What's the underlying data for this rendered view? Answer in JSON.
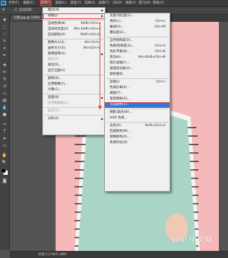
{
  "app": {
    "logo": "Ps"
  },
  "menubar": {
    "items": [
      {
        "label": "文件(F)",
        "active": false
      },
      {
        "label": "编辑(E)",
        "active": false
      },
      {
        "label": "图像(I)",
        "active": true
      },
      {
        "label": "图层(L)",
        "active": false
      },
      {
        "label": "类型(Y)",
        "active": false
      },
      {
        "label": "选择(S)",
        "active": false
      },
      {
        "label": "滤镜(T)",
        "active": false
      },
      {
        "label": "3D(D)",
        "active": false
      },
      {
        "label": "视图(V)",
        "active": false
      },
      {
        "label": "窗口(W)",
        "active": false
      },
      {
        "label": "帮助(H)",
        "active": false
      }
    ]
  },
  "options_bar": {
    "auto_select_label": "自动选择："
  },
  "document": {
    "tab_label": "人物.jpg @ 100%"
  },
  "status_bar": {
    "text": "文档:1.27M/5.28M"
  },
  "watermark": "php 中文网",
  "image_menu": {
    "items": [
      {
        "label": "模式(M)",
        "shortcut": "",
        "submenu": true
      },
      {
        "label": "调整(J)",
        "shortcut": "",
        "submenu": true,
        "highlight": true
      },
      {
        "sep": true
      },
      {
        "label": "自动色调(N)",
        "shortcut": "Shift+Ctrl+L"
      },
      {
        "label": "自动对比度(U)",
        "shortcut": "Alt+Shift+Ctrl+L"
      },
      {
        "label": "自动颜色(O)",
        "shortcut": "Shift+Ctrl+B"
      },
      {
        "sep": true
      },
      {
        "label": "图像大小(I)...",
        "shortcut": "Alt+Ctrl+I"
      },
      {
        "label": "画布大小(S)...",
        "shortcut": "Alt+Ctrl+C"
      },
      {
        "label": "图像旋转(G)",
        "shortcut": "",
        "submenu": true
      },
      {
        "label": "裁剪(P)",
        "shortcut": "",
        "disabled": true
      },
      {
        "label": "裁切(R)...",
        "shortcut": ""
      },
      {
        "label": "显示全部(V)",
        "shortcut": ""
      },
      {
        "sep": true
      },
      {
        "label": "复制(D)...",
        "shortcut": ""
      },
      {
        "label": "应用图像(Y)...",
        "shortcut": ""
      },
      {
        "label": "计算(C)...",
        "shortcut": ""
      },
      {
        "sep": true
      },
      {
        "label": "变量(B)",
        "shortcut": "",
        "submenu": true
      },
      {
        "label": "应用数据组(L)...",
        "shortcut": "",
        "disabled": true
      },
      {
        "sep": true
      },
      {
        "label": "陷印(T)...",
        "shortcut": "",
        "disabled": true
      },
      {
        "sep": true
      },
      {
        "label": "分析(A)",
        "shortcut": "",
        "submenu": true
      }
    ]
  },
  "adjust_menu": {
    "items": [
      {
        "label": "亮度/对比度(C)...",
        "shortcut": ""
      },
      {
        "label": "色阶(L)...",
        "shortcut": "Ctrl+L"
      },
      {
        "label": "曲线(U)...",
        "shortcut": "Ctrl+M"
      },
      {
        "label": "曝光度(E)...",
        "shortcut": ""
      },
      {
        "sep": true
      },
      {
        "label": "自然饱和度(V)...",
        "shortcut": ""
      },
      {
        "label": "色相/饱和度(H)...",
        "shortcut": "Ctrl+U"
      },
      {
        "label": "色彩平衡(B)...",
        "shortcut": "Ctrl+B"
      },
      {
        "label": "黑白(K)...",
        "shortcut": "Alt+Shift+Ctrl+B"
      },
      {
        "label": "照片滤镜(F)...",
        "shortcut": ""
      },
      {
        "label": "通道混合器(X)...",
        "shortcut": ""
      },
      {
        "label": "颜色查找...",
        "shortcut": ""
      },
      {
        "sep": true
      },
      {
        "label": "反相(I)",
        "shortcut": "Ctrl+I"
      },
      {
        "label": "色调分离(P)...",
        "shortcut": ""
      },
      {
        "label": "阈值(T)...",
        "shortcut": ""
      },
      {
        "label": "渐变映射(G)...",
        "shortcut": ""
      },
      {
        "label": "可选颜色(S)...",
        "shortcut": "",
        "highlight": true
      },
      {
        "sep": true
      },
      {
        "label": "阴影/高光(W)...",
        "shortcut": ""
      },
      {
        "label": "HDR 色调...",
        "shortcut": ""
      },
      {
        "sep": true
      },
      {
        "label": "去色(D)",
        "shortcut": "Shift+Ctrl+U"
      },
      {
        "label": "匹配颜色(M)...",
        "shortcut": ""
      },
      {
        "label": "替换颜色(R)...",
        "shortcut": ""
      },
      {
        "label": "色调均化(Q)",
        "shortcut": ""
      }
    ]
  },
  "colors": {
    "highlight": "#3178d8",
    "annotation": "#e23a3a",
    "canvas_bg": "#f2b7b7"
  }
}
